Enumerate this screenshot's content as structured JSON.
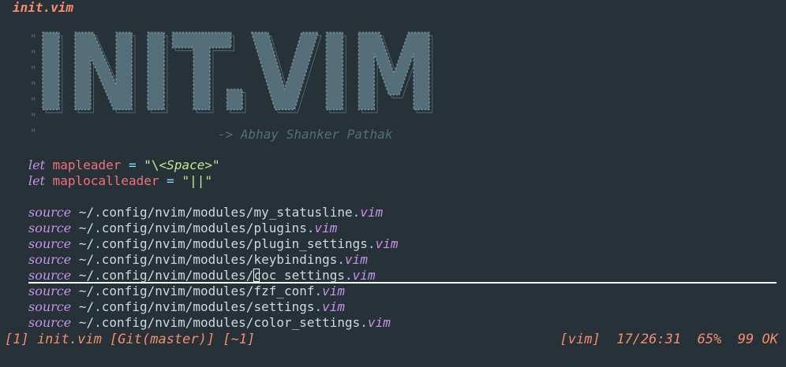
{
  "window": {
    "title": "init.vim"
  },
  "banner": {
    "quote": "\"",
    "text": "INIT.VIM",
    "author": "-> Abhay Shanker Pathak"
  },
  "lets": [
    {
      "keyword": "let",
      "name": "mapleader",
      "op": "=",
      "open": "\"\\",
      "special": "<Space>",
      "close": "\""
    },
    {
      "keyword": "let",
      "name": "maplocalleader",
      "op": "=",
      "value": "\"||\""
    }
  ],
  "sources": {
    "keyword": "source",
    "prefix": "~/",
    "items": [
      {
        "dir": "config/nvim/modules/",
        "file": "my_statusline",
        "ext": "vim"
      },
      {
        "dir": "config/nvim/modules/",
        "file": "plugins",
        "ext": "vim"
      },
      {
        "dir": "config/nvim/modules/",
        "file": "plugin_settings",
        "ext": "vim"
      },
      {
        "dir": "config/nvim/modules/",
        "file": "keybindings",
        "ext": "vim"
      },
      {
        "dir": "config/nvim/modules/",
        "file": "coc_settings",
        "ext": "vim"
      },
      {
        "dir": "config/nvim/modules/",
        "file": "fzf_conf",
        "ext": "vim"
      },
      {
        "dir": "config/nvim/modules/",
        "file": "settings",
        "ext": "vim"
      },
      {
        "dir": "config/nvim/modules/",
        "file": "color_settings",
        "ext": "vim"
      }
    ]
  },
  "statusline": {
    "buffer": "[1] init.vim [Git(master)] [~1]",
    "filetype": "[vim]",
    "position": "17/26:31",
    "percent": "65%",
    "count": "99",
    "status": "OK"
  },
  "colors": {
    "background": "#263238",
    "accent": "#f78c6c",
    "keyword": "#c792ea",
    "variable": "#f07178",
    "string": "#c3e88d",
    "comment": "#546e7a"
  }
}
